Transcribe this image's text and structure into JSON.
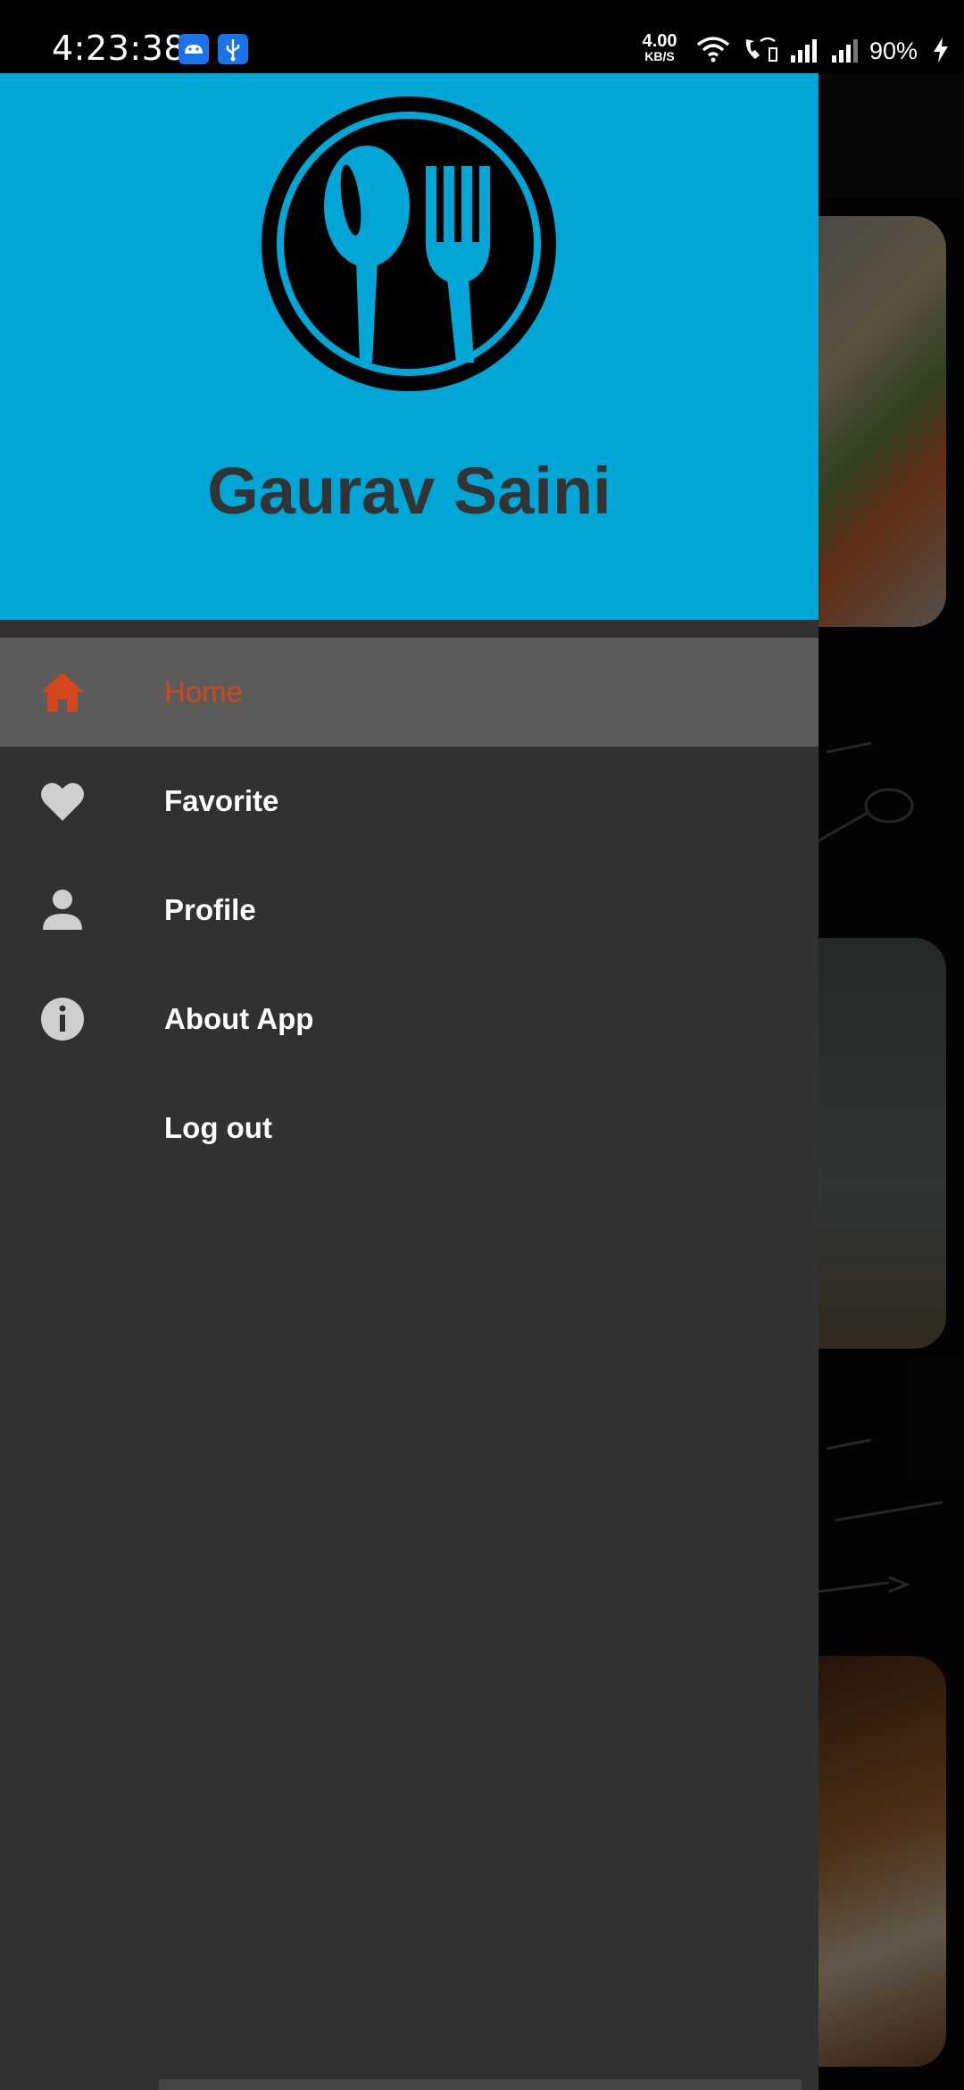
{
  "status_bar": {
    "time": "4:23:38",
    "speed_value": "4.00",
    "speed_unit": "KB/S",
    "battery": "90%",
    "icons": [
      "android-icon",
      "usb-icon",
      "wifi-icon",
      "wifi-calling-icon",
      "signal-icon",
      "signal-icon",
      "charging-icon"
    ]
  },
  "drawer": {
    "logo": "fork-spoon-logo",
    "user_name": "Gaurav Saini",
    "header_color": "#00a7d6",
    "menu": [
      {
        "label": "Home",
        "icon": "home-icon",
        "active": true
      },
      {
        "label": "Favorite",
        "icon": "heart-icon",
        "active": false
      },
      {
        "label": "Profile",
        "icon": "person-icon",
        "active": false
      },
      {
        "label": "About App",
        "icon": "info-icon",
        "active": false
      },
      {
        "label": "Log out",
        "icon": "",
        "active": false
      }
    ]
  },
  "colors": {
    "accent": "#d4461c",
    "drawer_bg": "#313131",
    "active_item_bg": "#5b5b5b"
  }
}
